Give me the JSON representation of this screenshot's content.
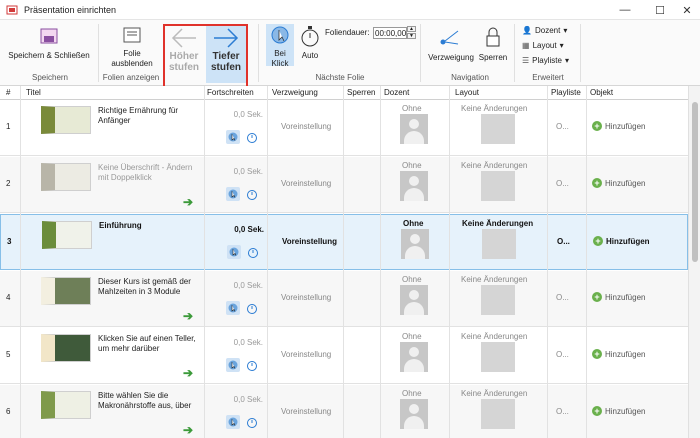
{
  "window": {
    "title": "Präsentation einrichten"
  },
  "ribbon": {
    "save_close": "Speichern & Schließen",
    "group_save": "Speichern",
    "hide_slide": "Folie ausblenden",
    "group_slides": "Folien anzeigen",
    "higher_l1": "Höher",
    "higher_l2": "stufen",
    "lower_l1": "Tiefer",
    "lower_l2": "stufen",
    "on_click_l1": "Bei",
    "on_click_l2": "Klick",
    "auto": "Auto",
    "duration_label": "Foliendauer:",
    "duration_value": "00:00,00",
    "group_next": "Nächste Folie",
    "branching": "Verzweigung",
    "lock": "Sperren",
    "group_nav": "Navigation",
    "presenter": "Dozent",
    "layout": "Layout",
    "playlist": "Playliste",
    "group_ext": "Erweitert"
  },
  "columns": [
    "#",
    "Titel",
    "Fortschreiten",
    "Verzweigung",
    "Sperren",
    "Dozent",
    "Layout",
    "Playliste",
    "Objekt"
  ],
  "rows": [
    {
      "num": "1",
      "title": "Richtige Ernährung für Anfänger",
      "progress": "0,0 Sek.",
      "branch": "Voreinstellung",
      "presenter": "Ohne",
      "layout": "Keine Änderungen",
      "playlist": "O...",
      "object": "Hinzufügen"
    },
    {
      "num": "2",
      "title": "Keine Überschrift - Ändern mit Doppelklick",
      "progress": "0,0 Sek.",
      "branch": "Voreinstellung",
      "presenter": "Ohne",
      "layout": "Keine Änderungen",
      "playlist": "O...",
      "object": "Hinzufügen"
    },
    {
      "num": "3",
      "title": "Einführung",
      "progress": "0,0 Sek.",
      "branch": "Voreinstellung",
      "presenter": "Ohne",
      "layout": "Keine Änderungen",
      "playlist": "O...",
      "object": "Hinzufügen"
    },
    {
      "num": "4",
      "title": "Dieser Kurs ist gemäß der Mahlzeiten in 3 Module",
      "progress": "0,0 Sek.",
      "branch": "Voreinstellung",
      "presenter": "Ohne",
      "layout": "Keine Änderungen",
      "playlist": "O...",
      "object": "Hinzufügen"
    },
    {
      "num": "5",
      "title": "Klicken Sie auf einen Teller, um mehr darüber",
      "progress": "0,0 Sek.",
      "branch": "Voreinstellung",
      "presenter": "Ohne",
      "layout": "Keine Änderungen",
      "playlist": "O...",
      "object": "Hinzufügen"
    },
    {
      "num": "6",
      "title": "Bitte wählen Sie die Makronährstoffe aus, über",
      "progress": "0,0 Sek.",
      "branch": "Voreinstellung",
      "presenter": "Ohne",
      "layout": "Keine Änderungen",
      "playlist": "O...",
      "object": "Hinzufügen"
    }
  ],
  "colors": {
    "accent": "#2b7cd3",
    "selection": "#e6f2fb",
    "highlight_border": "#e0322b",
    "add_green": "#6ab04c"
  }
}
